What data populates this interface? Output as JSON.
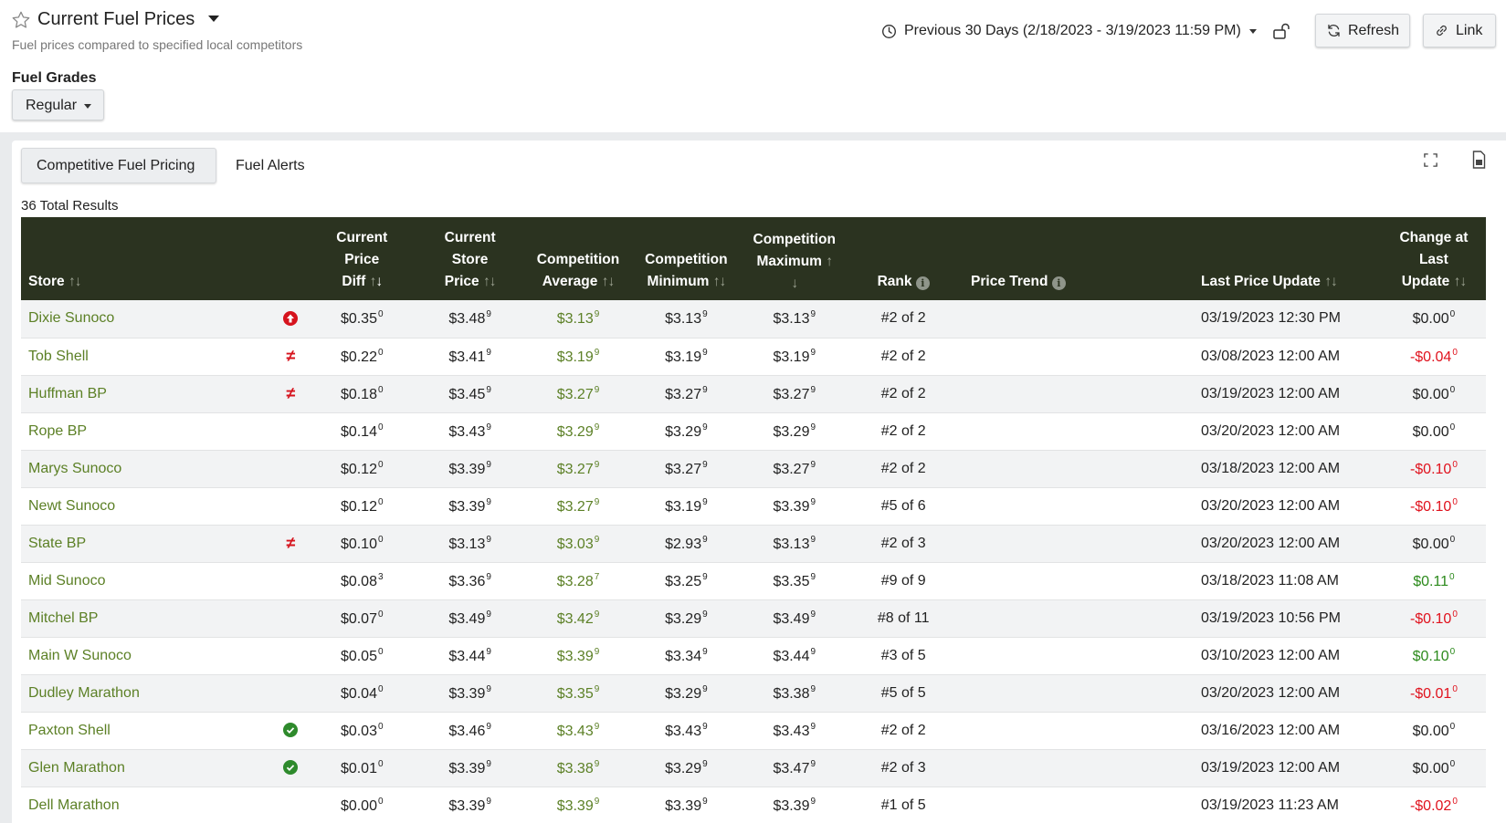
{
  "header": {
    "title": "Current Fuel Prices",
    "subtitle": "Fuel prices compared to specified local competitors",
    "date_range": "Previous 30 Days (2/18/2023 - 3/19/2023 11:59 PM)",
    "refresh_label": "Refresh",
    "link_label": "Link"
  },
  "filters": {
    "fuel_grades_label": "Fuel Grades",
    "fuel_grade_value": "Regular"
  },
  "tabs": [
    {
      "label": "Competitive Fuel Pricing",
      "active": true
    },
    {
      "label": "Fuel Alerts",
      "active": false
    }
  ],
  "results": {
    "total": "36 Total Results"
  },
  "columns": {
    "store": "Store",
    "current_price_diff": [
      "Current",
      "Price",
      "Diff"
    ],
    "current_store_price": [
      "Current",
      "Store",
      "Price"
    ],
    "competition_average": [
      "Competition",
      "Average"
    ],
    "competition_minimum": [
      "Competition",
      "Minimum"
    ],
    "competition_maximum": [
      "Competition",
      "Maximum"
    ],
    "rank": "Rank",
    "price_trend": "Price Trend",
    "last_price_update": "Last Price Update",
    "change_at_last_update": [
      "Change at",
      "Last",
      "Update"
    ]
  },
  "colors": {
    "header_bg": "#2b3320",
    "store_link": "#5c8026",
    "negative": "#e0121d",
    "positive": "#2c8a1c",
    "status_up": "#d6131d",
    "status_ok": "#2e8a2c"
  },
  "rows": [
    {
      "store": "Dixie Sunoco",
      "status": "up-arrow-icon",
      "diff": "$0.35",
      "diff_sup": "0",
      "price": "$3.48",
      "price_sup": "9",
      "avg": "$3.13",
      "avg_sup": "9",
      "min": "$3.13",
      "min_sup": "9",
      "max": "$3.13",
      "max_sup": "9",
      "rank": "#2 of 2",
      "updated": "03/19/2023 12:30 PM",
      "change": "$0.00",
      "change_sup": "0",
      "change_sign": "zero"
    },
    {
      "store": "Tob Shell",
      "status": "not-equal-icon",
      "diff": "$0.22",
      "diff_sup": "0",
      "price": "$3.41",
      "price_sup": "9",
      "avg": "$3.19",
      "avg_sup": "9",
      "min": "$3.19",
      "min_sup": "9",
      "max": "$3.19",
      "max_sup": "9",
      "rank": "#2 of 2",
      "updated": "03/08/2023 12:00 AM",
      "change": "-$0.04",
      "change_sup": "0",
      "change_sign": "neg"
    },
    {
      "store": "Huffman BP",
      "status": "not-equal-icon",
      "diff": "$0.18",
      "diff_sup": "0",
      "price": "$3.45",
      "price_sup": "9",
      "avg": "$3.27",
      "avg_sup": "9",
      "min": "$3.27",
      "min_sup": "9",
      "max": "$3.27",
      "max_sup": "9",
      "rank": "#2 of 2",
      "updated": "03/19/2023 12:00 AM",
      "change": "$0.00",
      "change_sup": "0",
      "change_sign": "zero"
    },
    {
      "store": "Rope BP",
      "status": "",
      "diff": "$0.14",
      "diff_sup": "0",
      "price": "$3.43",
      "price_sup": "9",
      "avg": "$3.29",
      "avg_sup": "9",
      "min": "$3.29",
      "min_sup": "9",
      "max": "$3.29",
      "max_sup": "9",
      "rank": "#2 of 2",
      "updated": "03/20/2023 12:00 AM",
      "change": "$0.00",
      "change_sup": "0",
      "change_sign": "zero"
    },
    {
      "store": "Marys Sunoco",
      "status": "",
      "diff": "$0.12",
      "diff_sup": "0",
      "price": "$3.39",
      "price_sup": "9",
      "avg": "$3.27",
      "avg_sup": "9",
      "min": "$3.27",
      "min_sup": "9",
      "max": "$3.27",
      "max_sup": "9",
      "rank": "#2 of 2",
      "updated": "03/18/2023 12:00 AM",
      "change": "-$0.10",
      "change_sup": "0",
      "change_sign": "neg"
    },
    {
      "store": "Newt Sunoco",
      "status": "",
      "diff": "$0.12",
      "diff_sup": "0",
      "price": "$3.39",
      "price_sup": "9",
      "avg": "$3.27",
      "avg_sup": "9",
      "min": "$3.19",
      "min_sup": "9",
      "max": "$3.39",
      "max_sup": "9",
      "rank": "#5 of 6",
      "updated": "03/20/2023 12:00 AM",
      "change": "-$0.10",
      "change_sup": "0",
      "change_sign": "neg"
    },
    {
      "store": "State BP",
      "status": "not-equal-icon",
      "diff": "$0.10",
      "diff_sup": "0",
      "price": "$3.13",
      "price_sup": "9",
      "avg": "$3.03",
      "avg_sup": "9",
      "min": "$2.93",
      "min_sup": "9",
      "max": "$3.13",
      "max_sup": "9",
      "rank": "#2 of 3",
      "updated": "03/20/2023 12:00 AM",
      "change": "$0.00",
      "change_sup": "0",
      "change_sign": "zero"
    },
    {
      "store": "Mid Sunoco",
      "status": "",
      "diff": "$0.08",
      "diff_sup": "3",
      "price": "$3.36",
      "price_sup": "9",
      "avg": "$3.28",
      "avg_sup": "7",
      "min": "$3.25",
      "min_sup": "9",
      "max": "$3.35",
      "max_sup": "9",
      "rank": "#9 of 9",
      "updated": "03/18/2023 11:08 AM",
      "change": "$0.11",
      "change_sup": "0",
      "change_sign": "pos"
    },
    {
      "store": "Mitchel BP",
      "status": "",
      "diff": "$0.07",
      "diff_sup": "0",
      "price": "$3.49",
      "price_sup": "9",
      "avg": "$3.42",
      "avg_sup": "9",
      "min": "$3.29",
      "min_sup": "9",
      "max": "$3.49",
      "max_sup": "9",
      "rank": "#8 of 11",
      "updated": "03/19/2023 10:56 PM",
      "change": "-$0.10",
      "change_sup": "0",
      "change_sign": "neg"
    },
    {
      "store": "Main W Sunoco",
      "status": "",
      "diff": "$0.05",
      "diff_sup": "0",
      "price": "$3.44",
      "price_sup": "9",
      "avg": "$3.39",
      "avg_sup": "9",
      "min": "$3.34",
      "min_sup": "9",
      "max": "$3.44",
      "max_sup": "9",
      "rank": "#3 of 5",
      "updated": "03/10/2023 12:00 AM",
      "change": "$0.10",
      "change_sup": "0",
      "change_sign": "pos"
    },
    {
      "store": "Dudley Marathon",
      "status": "",
      "diff": "$0.04",
      "diff_sup": "0",
      "price": "$3.39",
      "price_sup": "9",
      "avg": "$3.35",
      "avg_sup": "9",
      "min": "$3.29",
      "min_sup": "9",
      "max": "$3.38",
      "max_sup": "9",
      "rank": "#5 of 5",
      "updated": "03/20/2023 12:00 AM",
      "change": "-$0.01",
      "change_sup": "0",
      "change_sign": "neg"
    },
    {
      "store": "Paxton Shell",
      "status": "check-circle-icon",
      "diff": "$0.03",
      "diff_sup": "0",
      "price": "$3.46",
      "price_sup": "9",
      "avg": "$3.43",
      "avg_sup": "9",
      "min": "$3.43",
      "min_sup": "9",
      "max": "$3.43",
      "max_sup": "9",
      "rank": "#2 of 2",
      "updated": "03/16/2023 12:00 AM",
      "change": "$0.00",
      "change_sup": "0",
      "change_sign": "zero"
    },
    {
      "store": "Glen Marathon",
      "status": "check-circle-icon",
      "diff": "$0.01",
      "diff_sup": "0",
      "price": "$3.39",
      "price_sup": "9",
      "avg": "$3.38",
      "avg_sup": "9",
      "min": "$3.29",
      "min_sup": "9",
      "max": "$3.47",
      "max_sup": "9",
      "rank": "#2 of 3",
      "updated": "03/19/2023 12:00 AM",
      "change": "$0.00",
      "change_sup": "0",
      "change_sign": "zero"
    },
    {
      "store": "Dell Marathon",
      "status": "",
      "diff": "$0.00",
      "diff_sup": "0",
      "price": "$3.39",
      "price_sup": "9",
      "avg": "$3.39",
      "avg_sup": "9",
      "min": "$3.39",
      "min_sup": "9",
      "max": "$3.39",
      "max_sup": "9",
      "rank": "#1 of 5",
      "updated": "03/19/2023 11:23 AM",
      "change": "-$0.02",
      "change_sup": "0",
      "change_sign": "neg"
    }
  ]
}
